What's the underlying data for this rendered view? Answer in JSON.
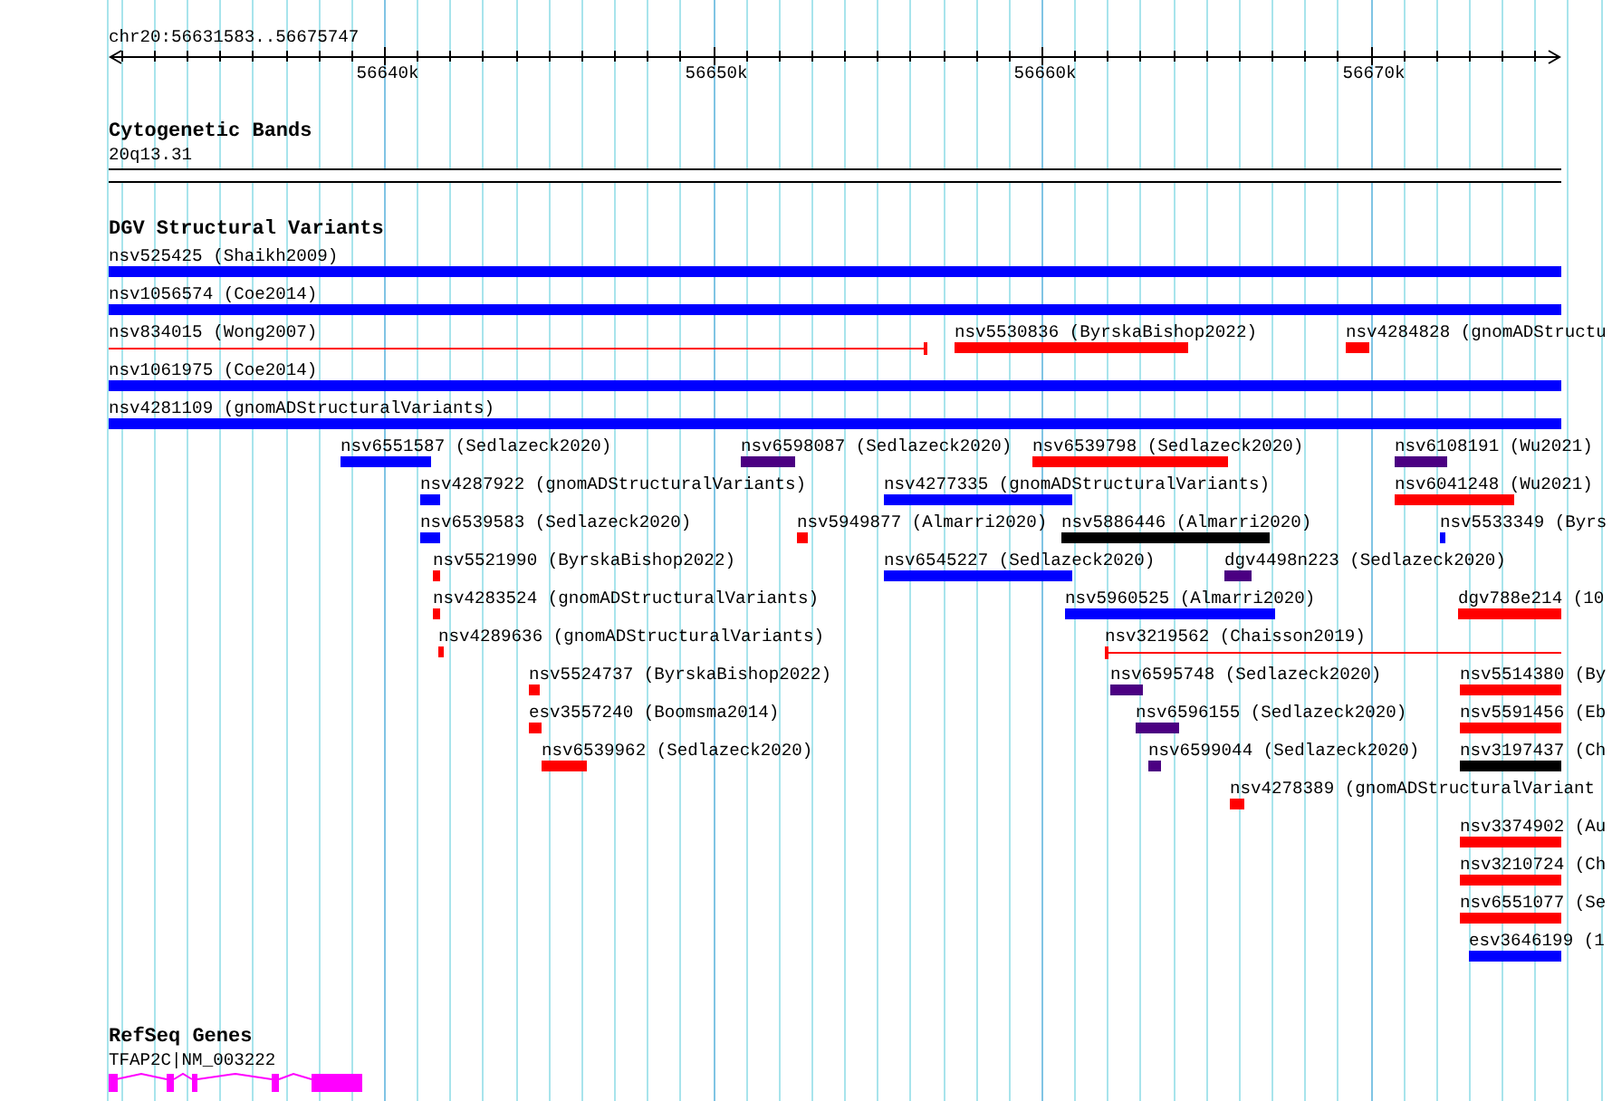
{
  "ruler": {
    "location": "chr20:56631583..56675747",
    "ticks": [
      "56640k",
      "56650k",
      "56660k",
      "56670k"
    ]
  },
  "tracks": [
    {
      "title": "Cytogenetic Bands",
      "kind": "bands",
      "features": [
        {
          "label": "20q13.31"
        }
      ]
    },
    {
      "title": "DGV Structural Variants",
      "kind": "variants",
      "rows": [
        {
          "features": [
            {
              "label": "nsv525425 (Shaikh2009)",
              "color": "#0000ff",
              "kind": "bar"
            }
          ]
        },
        {
          "features": [
            {
              "label": "nsv1056574 (Coe2014)",
              "color": "#0000ff",
              "kind": "bar"
            }
          ]
        },
        {
          "features": [
            {
              "label": "nsv834015 (Wong2007)",
              "color": "#ff0000",
              "kind": "line"
            },
            {
              "label": "nsv5530836 (ByrskaBishop2022)",
              "color": "#ff0000",
              "kind": "bar"
            },
            {
              "label": "nsv4284828 (gnomADStructu",
              "color": "#ff0000",
              "kind": "bar"
            }
          ]
        },
        {
          "features": [
            {
              "label": "nsv1061975 (Coe2014)",
              "color": "#0000ff",
              "kind": "bar"
            }
          ]
        },
        {
          "features": [
            {
              "label": "nsv4281109 (gnomADStructuralVariants)",
              "color": "#0000ff",
              "kind": "bar"
            }
          ]
        },
        {
          "features": [
            {
              "label": "nsv6551587 (Sedlazeck2020)",
              "color": "#0000ff",
              "kind": "bar"
            },
            {
              "label": "nsv6598087 (Sedlazeck2020)",
              "color": "#4b0082",
              "kind": "bar"
            },
            {
              "label": "nsv6539798 (Sedlazeck2020)",
              "color": "#ff0000",
              "kind": "bar"
            },
            {
              "label": "nsv6108191 (Wu2021)",
              "color": "#4b0082",
              "kind": "bar"
            }
          ]
        },
        {
          "features": [
            {
              "label": "nsv4287922 (gnomADStructuralVariants)",
              "color": "#0000ff",
              "kind": "bar"
            },
            {
              "label": "nsv4277335 (gnomADStructuralVariants)",
              "color": "#0000ff",
              "kind": "bar"
            },
            {
              "label": "nsv6041248 (Wu2021)",
              "color": "#ff0000",
              "kind": "bar"
            }
          ]
        },
        {
          "features": [
            {
              "label": "nsv6539583 (Sedlazeck2020)",
              "color": "#0000ff",
              "kind": "bar"
            },
            {
              "label": "nsv5949877 (Almarri2020)",
              "color": "#ff0000",
              "kind": "bar"
            },
            {
              "label": "nsv5886446 (Almarri2020)",
              "color": "#000000",
              "kind": "bar"
            },
            {
              "label": "nsv5533349 (Byrs",
              "color": "#0000ff",
              "kind": "bar"
            }
          ]
        },
        {
          "features": [
            {
              "label": "nsv5521990 (ByrskaBishop2022)",
              "color": "#ff0000",
              "kind": "bar"
            },
            {
              "label": "nsv6545227 (Sedlazeck2020)",
              "color": "#0000ff",
              "kind": "bar"
            },
            {
              "label": "dgv4498n223 (Sedlazeck2020)",
              "color": "#4b0082",
              "kind": "bar"
            }
          ]
        },
        {
          "features": [
            {
              "label": "nsv4283524 (gnomADStructuralVariants)",
              "color": "#ff0000",
              "kind": "bar"
            },
            {
              "label": "nsv5960525 (Almarri2020)",
              "color": "#0000ff",
              "kind": "bar"
            },
            {
              "label": "dgv788e214 (10",
              "color": "#ff0000",
              "kind": "bar"
            }
          ]
        },
        {
          "features": [
            {
              "label": "nsv4289636 (gnomADStructuralVariants)",
              "color": "#ff0000",
              "kind": "bar"
            },
            {
              "label": "nsv3219562 (Chaisson2019)",
              "color": "#ff0000",
              "kind": "line"
            }
          ]
        },
        {
          "features": [
            {
              "label": "nsv5524737 (ByrskaBishop2022)",
              "color": "#ff0000",
              "kind": "bar"
            },
            {
              "label": "nsv6595748 (Sedlazeck2020)",
              "color": "#4b0082",
              "kind": "bar"
            },
            {
              "label": "nsv5514380 (By",
              "color": "#ff0000",
              "kind": "bar"
            }
          ]
        },
        {
          "features": [
            {
              "label": "esv3557240 (Boomsma2014)",
              "color": "#ff0000",
              "kind": "bar"
            },
            {
              "label": "nsv6596155 (Sedlazeck2020)",
              "color": "#4b0082",
              "kind": "bar"
            },
            {
              "label": "nsv5591456 (Eb",
              "color": "#ff0000",
              "kind": "bar"
            }
          ]
        },
        {
          "features": [
            {
              "label": "nsv6539962 (Sedlazeck2020)",
              "color": "#ff0000",
              "kind": "bar"
            },
            {
              "label": "nsv6599044 (Sedlazeck2020)",
              "color": "#4b0082",
              "kind": "bar"
            },
            {
              "label": "nsv3197437 (Ch",
              "color": "#000000",
              "kind": "bar"
            }
          ]
        },
        {
          "features": [
            {
              "label": "nsv4278389 (gnomADStructuralVariant",
              "color": "#ff0000",
              "kind": "bar"
            }
          ]
        },
        {
          "features": [
            {
              "label": "nsv3374902 (Au",
              "color": "#ff0000",
              "kind": "bar"
            }
          ]
        },
        {
          "features": [
            {
              "label": "nsv3210724 (Ch",
              "color": "#ff0000",
              "kind": "bar"
            }
          ]
        },
        {
          "features": [
            {
              "label": "nsv6551077 (Se",
              "color": "#ff0000",
              "kind": "bar"
            }
          ]
        },
        {
          "features": [
            {
              "label": "esv3646199 (1",
              "color": "#0000ff",
              "kind": "bar"
            }
          ]
        }
      ]
    },
    {
      "title": "RefSeq Genes",
      "kind": "genes",
      "features": [
        {
          "label": "TFAP2C|NM_003222"
        }
      ]
    }
  ]
}
